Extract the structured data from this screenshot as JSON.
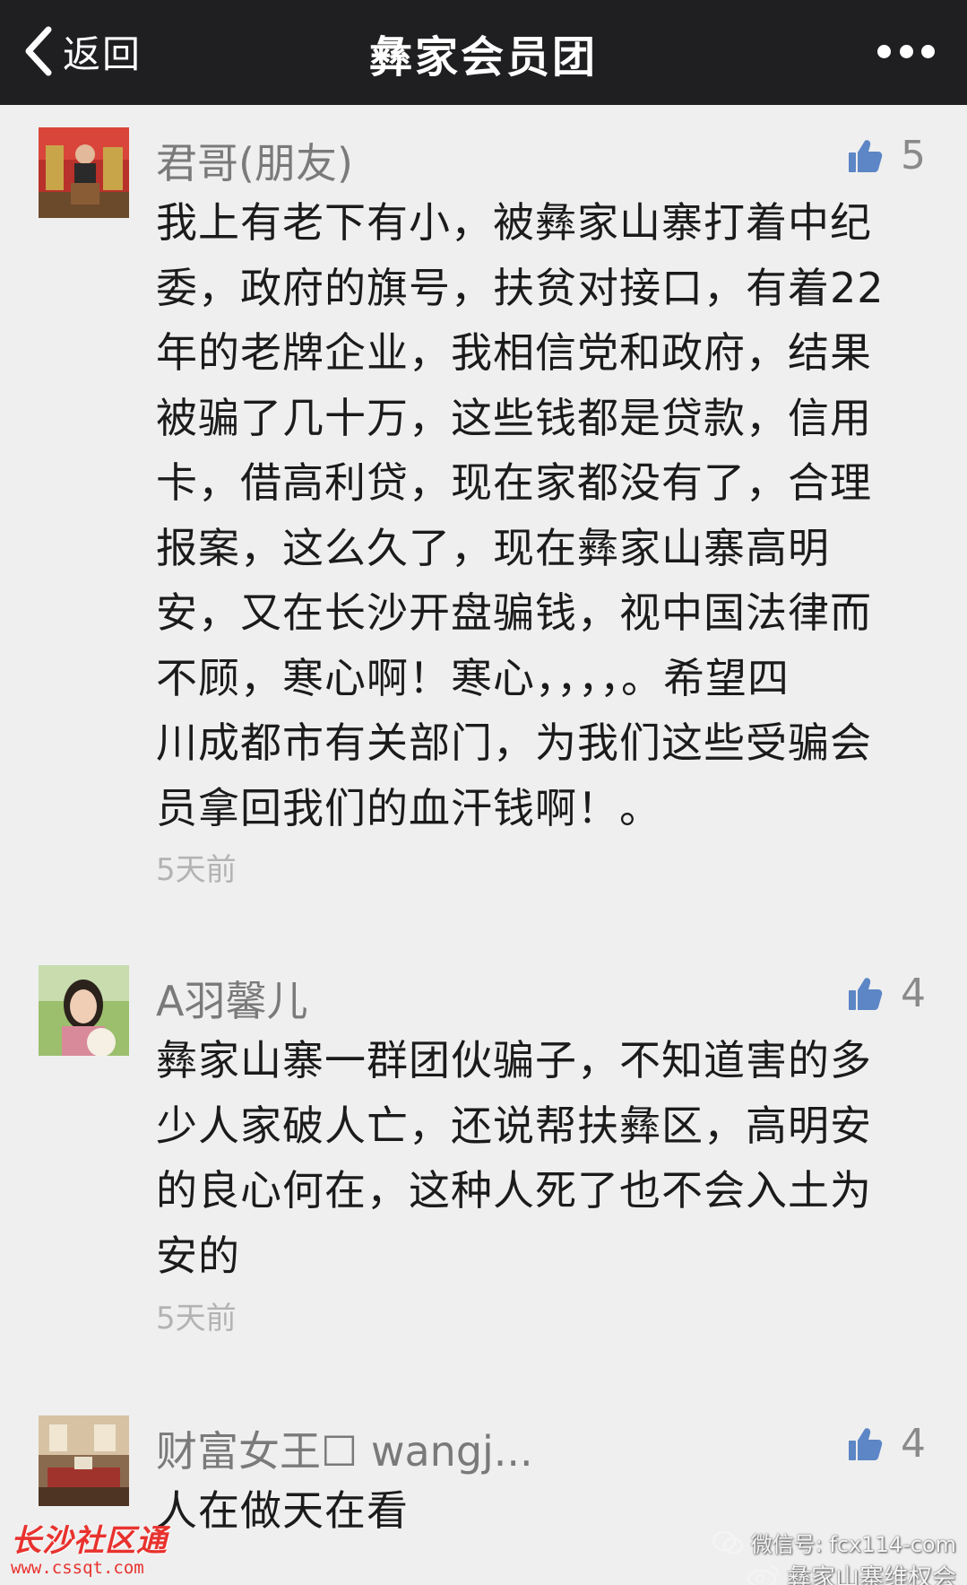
{
  "navbar": {
    "back_label": "返回",
    "title": "彝家会员团"
  },
  "comments": [
    {
      "nickname": "君哥(朋友)",
      "likes": "5",
      "lines": [
        "我上有老下有小，被彝家山寨打着中纪",
        "委，政府的旗号，扶贫对接口，有着22",
        "年的老牌企业，我相信党和政府，结果",
        "被骗了几十万，这些钱都是贷款，信用",
        "卡，借高利贷，现在家都没有了，合理",
        "报案，这么久了，现在彝家山寨高明",
        "安，又在长沙开盘骗钱，视中国法律而",
        "不顾，寒心啊！寒心，，，，。希望四",
        "川成都市有关部门，为我们这些受骗会",
        "员拿回我们的血汗钱啊！。"
      ],
      "time": "5天前"
    },
    {
      "nickname": "A羽馨儿",
      "likes": "4",
      "lines": [
        "彝家山寨一群团伙骗子，不知道害的多",
        "少人家破人亡，还说帮扶彝区，高明安",
        "的良心何在，这种人死了也不会入土为",
        "安的"
      ],
      "time": "5天前"
    },
    {
      "nickname": "财富女王☐ wangj...",
      "likes": "4",
      "lines": [
        "人在做天在看"
      ]
    }
  ],
  "watermarks": {
    "left_title": "长沙社区通",
    "left_url": "www.cssqt.com",
    "right_line1": "微信号: fcx114-com",
    "right_line2": "彝家山寨维权会"
  },
  "colors": {
    "navbar_bg": "#1f1f21",
    "page_bg": "#efefef",
    "like_icon": "#5c86c5",
    "watermark_red": "#e8322e"
  }
}
